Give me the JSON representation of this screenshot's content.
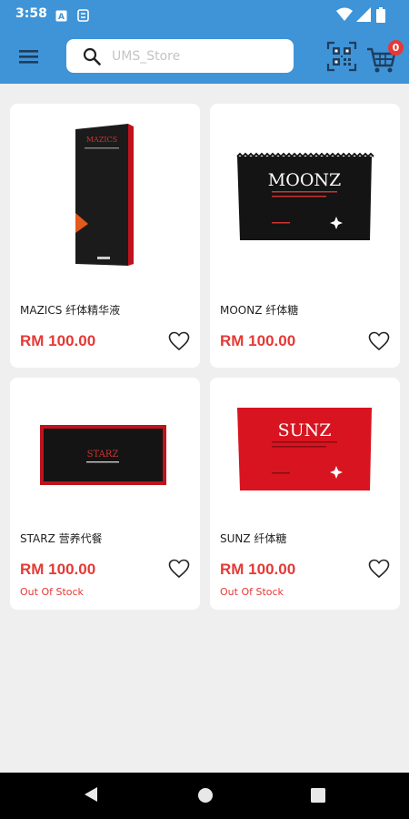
{
  "status_bar": {
    "time": "3:58",
    "icons": [
      "a-icon",
      "sync-icon",
      "wifi-icon",
      "signal-icon",
      "battery-icon"
    ]
  },
  "app_bar": {
    "menu_icon": "hamburger-menu-icon",
    "search_placeholder": "UMS_Store",
    "qr_icon": "qr-scan-icon",
    "cart_icon": "cart-icon",
    "cart_count": "0"
  },
  "products": [
    {
      "name": "MAZICS 纤体精华液",
      "price": "RM 100.00",
      "stock_status": "",
      "image_icon": "mazics-bottle-image",
      "packaging_text": "MAZICS"
    },
    {
      "name": "MOONZ 纤体糖",
      "price": "RM 100.00",
      "stock_status": "",
      "image_icon": "moonz-packet-image",
      "packaging_text": "MOONZ"
    },
    {
      "name": "STARZ 营养代餐",
      "price": "RM 100.00",
      "stock_status": "Out Of Stock",
      "image_icon": "starz-box-image",
      "packaging_text": "STARZ"
    },
    {
      "name": "SUNZ 纤体糖",
      "price": "RM 100.00",
      "stock_status": "Out Of Stock",
      "image_icon": "sunz-packet-image",
      "packaging_text": "SUNZ"
    }
  ],
  "colors": {
    "app_bar": "#3f94d7",
    "price": "#e53935",
    "background": "#efefef"
  },
  "nav_bar": {
    "icons": [
      "back-icon",
      "home-icon",
      "recents-icon"
    ]
  }
}
